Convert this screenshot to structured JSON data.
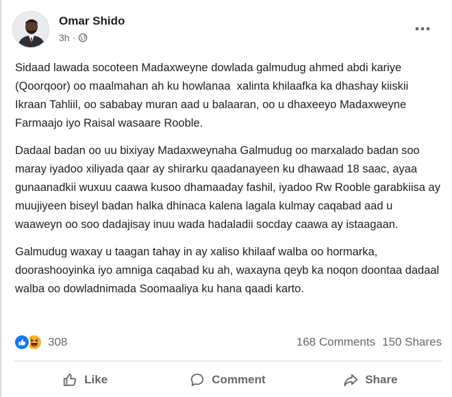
{
  "post": {
    "author": "Omar Shido",
    "time": "3h",
    "separator": "·",
    "privacy_icon": "globe-icon",
    "paragraphs": [
      "Sidaad lawada socoteen Madaxweyne dowlada galmudug ahmed abdi kariye (Qoorqoor) oo maalmahan ah ku howlanaa  xalinta khilaafka ka dhashay kiiskii  Ikraan Tahliil, oo sababay muran aad u balaaran, oo u dhaxeeyo Madaxweyne Farmaajo iyo Raisal wasaare Rooble.",
      "Dadaal badan oo uu bixiyay Madaxweynaha Galmudug oo marxalado badan soo maray iyadoo xiliyada qaar ay shirarku qaadanayeen ku dhawaad 18 saac, ayaa gunaanadkii wuxuu caawa kusoo dhamaaday fashil, iyadoo Rw Rooble garabkiisa ay muujiyeen biseyl badan halka dhinaca kalena lagala kulmay caqabad aad u waaweyn oo soo dadajisay inuu wada hadaladii socday caawa ay istaagaan.",
      "Galmudug waxay u taagan tahay in ay xaliso khilaaf walba oo hormarka,  doorashooyinka iyo amniga caqabad ku ah, waxayna qeyb ka noqon doontaa dadaal walba oo dowladnimada Soomaaliya ku hana qaadi karto."
    ]
  },
  "stats": {
    "reaction_count": "308",
    "comments": "168 Comments",
    "shares": "150 Shares"
  },
  "actions": {
    "like": "Like",
    "comment": "Comment",
    "share": "Share"
  },
  "colors": {
    "like_blue": "#1877f2",
    "haha_yellow": "#f7b125",
    "secondary_text": "#65676b"
  }
}
